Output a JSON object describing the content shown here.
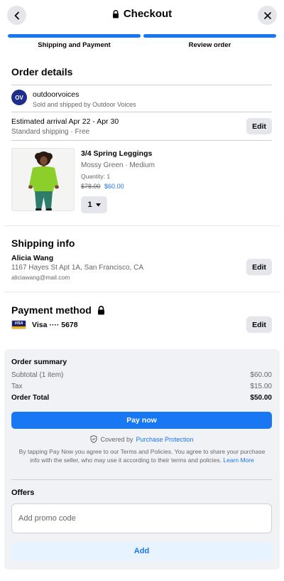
{
  "header": {
    "title": "Checkout",
    "back_icon": "back-arrow-icon",
    "close_icon": "close-icon",
    "lock_icon": "lock-icon"
  },
  "steps": [
    {
      "label": "Shipping and Payment",
      "active": true
    },
    {
      "label": "Review order",
      "active": true
    }
  ],
  "order_details": {
    "title": "Order details",
    "seller": {
      "logo_text": "OV",
      "name": "outdoorvoices",
      "subtitle": "Sold and shipped by Outdoor Voices"
    },
    "delivery": {
      "estimate": "Estimated arrival Apr 22 - Apr 30",
      "method": "Standard shipping · Free",
      "edit_label": "Edit"
    },
    "item": {
      "name": "3/4 Spring Leggings",
      "variant": "Mossy Green · Medium",
      "quantity_text": "Quantity: 1",
      "original_price": "$78.00",
      "sale_price": "$60.00",
      "qty_selected": "1"
    }
  },
  "shipping_info": {
    "title": "Shipping info",
    "name": "Alicia Wang",
    "address": "1167 Hayes St Apt 1A, San Francisco, CA",
    "email": "aliciawang@mail.com",
    "edit_label": "Edit"
  },
  "payment": {
    "title": "Payment method",
    "card_brand_logo": "VISA",
    "card_label": "Visa ···· 5678",
    "edit_label": "Edit"
  },
  "summary": {
    "title": "Order summary",
    "rows": [
      {
        "label": "Subtotal (1 item)",
        "value": "$60.00"
      },
      {
        "label": "Tax",
        "value": "$15.00"
      },
      {
        "label": "Order Total",
        "value": "$50.00"
      }
    ],
    "pay_button": "Pay now",
    "protection_prefix": "Covered by",
    "protection_link": "Purchase Protection",
    "terms_text": "By tapping Pay Now you agree to our Terms and Policies. You agree to share your purchase info with the seller, who may use it according to their terms and policies.",
    "terms_link": "Learn More"
  },
  "offers": {
    "title": "Offers",
    "promo_placeholder": "Add promo code",
    "promo_value": "",
    "add_button": "Add"
  },
  "colors": {
    "accent": "#1877f2",
    "button_bg": "#e4e6eb",
    "panel_bg": "#f0f2f5",
    "text_secondary": "#65676b"
  }
}
